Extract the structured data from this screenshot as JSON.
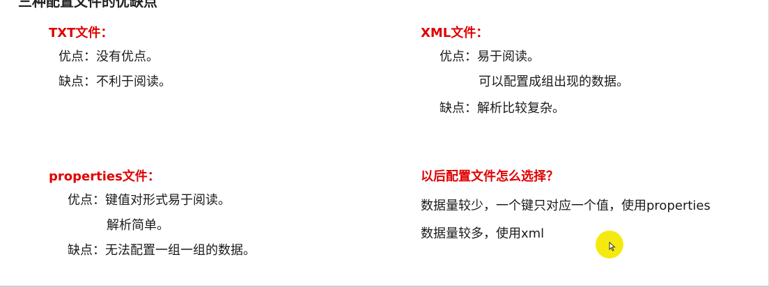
{
  "title": "三种配置文件的优缺点",
  "sections": {
    "txt": {
      "heading": "TXT文件：",
      "pro": "优点：没有优点。",
      "con": "缺点：不利于阅读。"
    },
    "xml": {
      "heading": "XML文件：",
      "pro": "优点：易于阅读。",
      "pro2": "可以配置成组出现的数据。",
      "con": "缺点：解析比较复杂。"
    },
    "properties": {
      "heading": "properties文件：",
      "pro": "优点：键值对形式易于阅读。",
      "pro2": "解析简单。",
      "con": "缺点：无法配置一组一组的数据。"
    },
    "choice": {
      "heading": "以后配置文件怎么选择？",
      "line1": "数据量较少，一个键只对应一个值，使用properties",
      "line2": "数据量较多，使用xml"
    }
  },
  "colors": {
    "heading": "#e00000",
    "text": "#1a1a1a",
    "cursor_highlight": "#f5ea10"
  },
  "icons": [
    "mouse-cursor-icon"
  ]
}
